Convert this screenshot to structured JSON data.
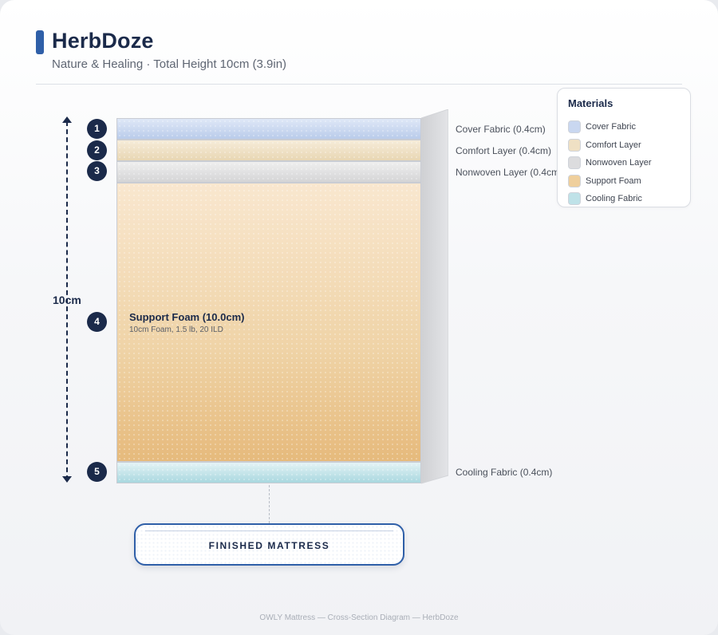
{
  "header": {
    "title": "HerbDoze",
    "subtitle": "Nature & Healing · Total Height 10cm (3.9in)"
  },
  "dimension": {
    "label": "10cm"
  },
  "layers": [
    {
      "number": "1",
      "label": "Cover Fabric (0.4cm)",
      "material": "Cover Fabric",
      "color": "#c9d7f0"
    },
    {
      "number": "2",
      "label": "Comfort Layer (0.4cm)",
      "material": "Comfort Layer",
      "color": "#efe0c4"
    },
    {
      "number": "3",
      "label": "Nonwoven Layer (0.4cm)",
      "material": "Nonwoven Layer",
      "color": "#e0e0e2"
    },
    {
      "number": "4",
      "title": "Support Foam (10.0cm)",
      "spec": "10cm Foam, 1.5 lb, 20 ILD",
      "material": "Support Foam",
      "color": "#efcf9c"
    },
    {
      "number": "5",
      "label": "Cooling Fabric (0.4cm)",
      "material": "Cooling Fabric",
      "color": "#bfe2e8"
    }
  ],
  "legend": {
    "title": "Materials",
    "items": [
      {
        "label": "Cover Fabric",
        "color": "#c9d7f0"
      },
      {
        "label": "Comfort Layer",
        "color": "#efe0c4"
      },
      {
        "label": "Nonwoven Layer",
        "color": "#dcdcde"
      },
      {
        "label": "Support Foam",
        "color": "#efcf9c"
      },
      {
        "label": "Cooling Fabric",
        "color": "#bfe2e8"
      }
    ]
  },
  "finished": {
    "label": "FINISHED MATTRESS"
  },
  "footer": {
    "text": "OWLY Mattress — Cross-Section Diagram — HerbDoze"
  }
}
